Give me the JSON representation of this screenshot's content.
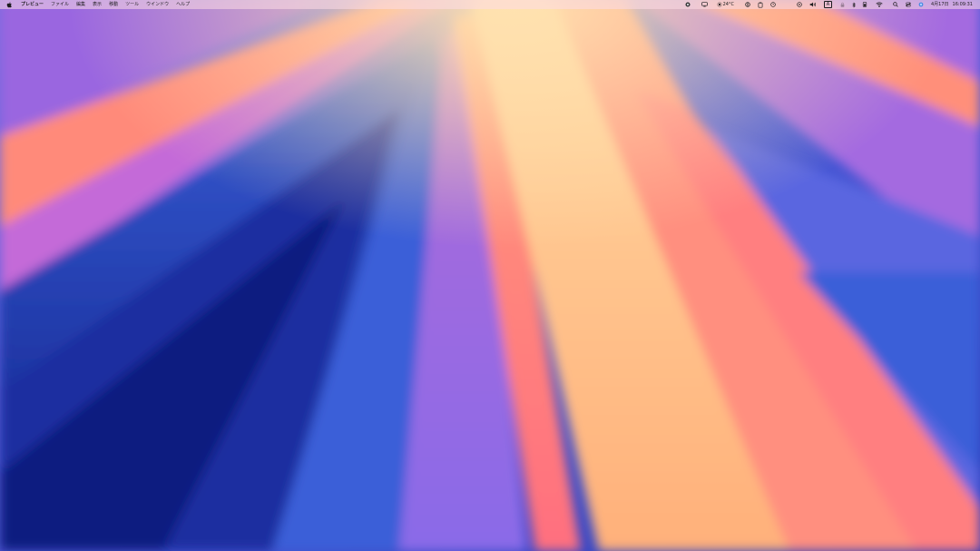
{
  "menubar": {
    "app_name": "プレビュー",
    "menus": [
      "ファイル",
      "編集",
      "表示",
      "移動",
      "ツール",
      "ウインドウ",
      "ヘルプ"
    ],
    "weather_temp": "24°C",
    "input_source": "A",
    "date": "4月17日",
    "time": "16:09:31"
  },
  "icons": {
    "apple": "apple-logo-icon",
    "screen_record": "record-icon",
    "display": "display-icon",
    "weather": "sun-icon",
    "copilot": "circle-letter-icon",
    "clipboard": "clipboard-icon",
    "timer": "clock-icon",
    "play": "play-circle-icon",
    "volume": "speaker-icon",
    "wifi": "wifi-icon",
    "search": "search-icon",
    "control_center": "control-center-icon",
    "siri": "siri-icon"
  },
  "colors": {
    "menubar_text": "#1d1d1f",
    "wallpaper_deep_blue": "#1a2a9a",
    "wallpaper_purple": "#8a5fd8",
    "wallpaper_coral": "#ff7f7a",
    "wallpaper_peach": "#ffc98a"
  }
}
